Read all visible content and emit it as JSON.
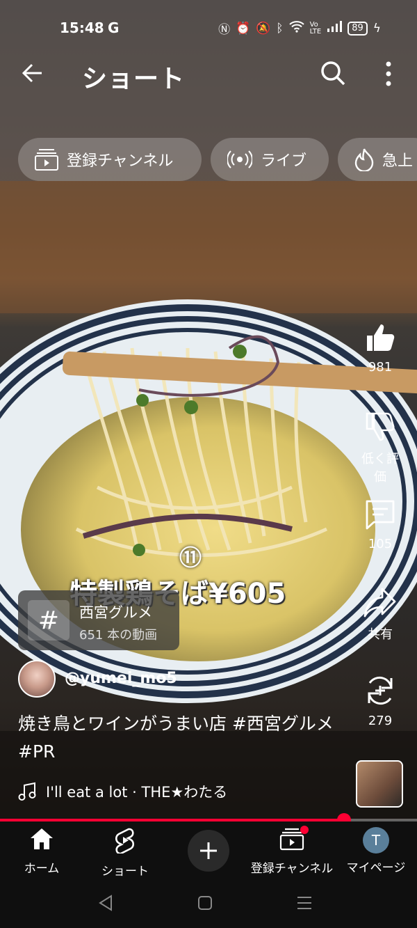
{
  "status_bar": {
    "time": "15:48",
    "google": "G",
    "battery": "89"
  },
  "header": {
    "title": "ショート"
  },
  "chips": [
    {
      "label": "登録チャンネル"
    },
    {
      "label": "ライブ"
    },
    {
      "label": "急上"
    }
  ],
  "video_overlay": {
    "line1": "⑪",
    "line2": "特製鶏そば¥605"
  },
  "hashtag_card": {
    "name": "西宮グルメ",
    "count": "651 本の動画"
  },
  "channel": {
    "handle": "@yumei_mo5"
  },
  "caption": "焼き鳥とワインがうまい店 #西宮グルメ #PR",
  "music": {
    "text": "I'll eat a lot · THE★わたる"
  },
  "actions": {
    "like_count": "981",
    "dislike_label": "低く評価",
    "comment_count": "105",
    "share_label": "共有",
    "remix_count": "279"
  },
  "progress": {
    "fraction": 0.825
  },
  "bottom_nav": {
    "home": "ホーム",
    "shorts": "ショート",
    "subscriptions": "登録チャンネル",
    "mypage": "マイページ",
    "avatar_letter": "T"
  },
  "colors": {
    "accent": "#ff0033",
    "nav_bg": "#0f0f0f"
  }
}
